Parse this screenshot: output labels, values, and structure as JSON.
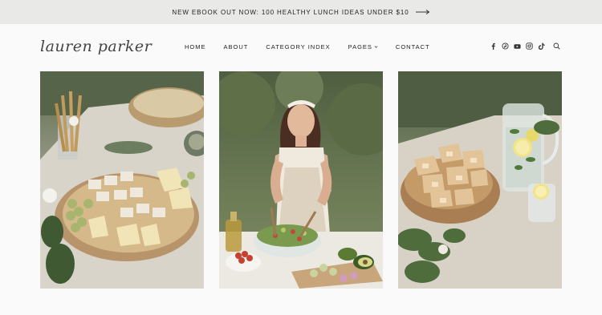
{
  "announcement": {
    "text": "NEW EBOOK OUT NOW: 100 HEALTHY LUNCH IDEAS UNDER $10",
    "arrow_icon": "long-arrow-right-icon"
  },
  "logo": {
    "text": "lauren parker"
  },
  "nav": {
    "items": [
      {
        "label": "HOME"
      },
      {
        "label": "ABOUT"
      },
      {
        "label": "CATEGORY INDEX"
      },
      {
        "label": "PAGES",
        "has_dropdown": true
      },
      {
        "label": "CONTACT"
      }
    ]
  },
  "social": {
    "icons": [
      "facebook-icon",
      "pinterest-icon",
      "youtube-icon",
      "instagram-icon",
      "tiktok-icon",
      "search-icon"
    ]
  },
  "photos": [
    {
      "subject": "cheese-board-grapes-breadsticks"
    },
    {
      "subject": "woman-tossing-salad"
    },
    {
      "subject": "bread-board-lemon-water-pitcher"
    }
  ],
  "colors": {
    "topbar_bg": "#e9e9e8",
    "page_bg": "#fafafa",
    "text": "#222222"
  }
}
